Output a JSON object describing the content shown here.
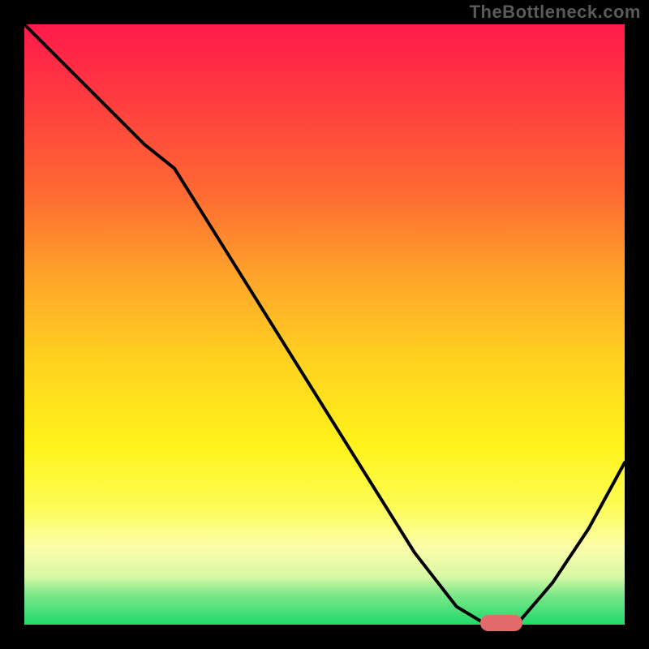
{
  "watermark": "TheBottleneck.com",
  "colors": {
    "page_bg": "#000000",
    "curve": "#000000",
    "marker": "#e26a6a",
    "gradient_stops": [
      {
        "pct": 0,
        "color": "#ff1a4b"
      },
      {
        "pct": 12,
        "color": "#ff3a3f"
      },
      {
        "pct": 28,
        "color": "#ff6a33"
      },
      {
        "pct": 42,
        "color": "#ffa42a"
      },
      {
        "pct": 56,
        "color": "#ffd21f"
      },
      {
        "pct": 70,
        "color": "#fff21a"
      },
      {
        "pct": 80,
        "color": "#fdfd52"
      },
      {
        "pct": 87,
        "color": "#fbfda8"
      },
      {
        "pct": 92,
        "color": "#d8f9a4"
      },
      {
        "pct": 95,
        "color": "#7de88a"
      },
      {
        "pct": 100,
        "color": "#1fd96a"
      }
    ]
  },
  "chart_data": {
    "type": "line",
    "title": "",
    "xlabel": "",
    "ylabel": "",
    "xlim": [
      0,
      100
    ],
    "ylim": [
      0,
      100
    ],
    "note": "No axis tick labels are visible. x and y values are estimated on a 0–100 normalized scale from the plot area.",
    "series": [
      {
        "name": "bottleneck-curve",
        "x": [
          0,
          10,
          20,
          25,
          35,
          45,
          55,
          65,
          72,
          77,
          82,
          88,
          94,
          100
        ],
        "y": [
          100,
          90,
          80,
          76,
          60,
          44,
          28,
          12,
          3,
          0,
          0,
          7,
          16,
          27
        ]
      }
    ],
    "marker": {
      "name": "highlight-range",
      "x_start": 76,
      "x_end": 83,
      "y": 0
    }
  }
}
